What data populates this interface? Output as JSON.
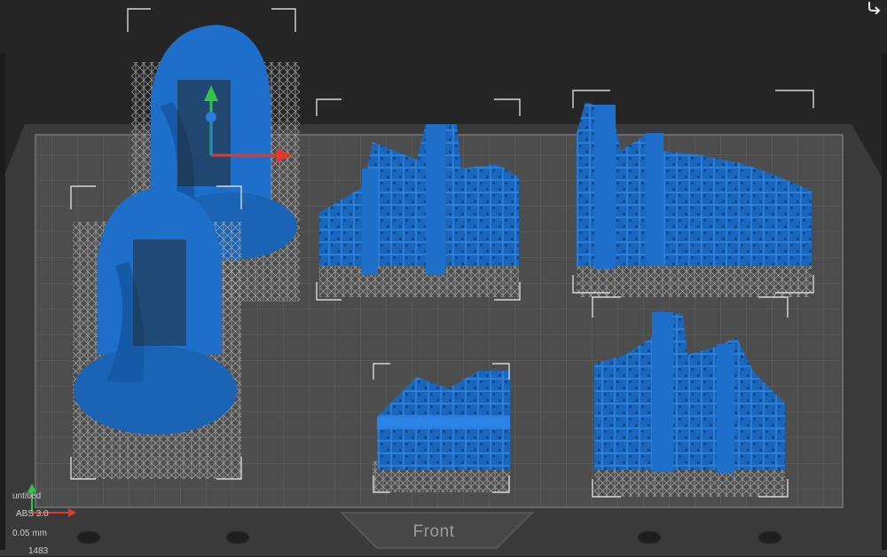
{
  "viewport": {
    "plate_label": "Front",
    "plate_color": "#4d4d4d",
    "grid_color": "#5c5c5c",
    "model_color": "#1e6fc9",
    "support_color": "#a7a7a7",
    "model_count": 6
  },
  "gizmo": {
    "x_axis_color": "#e03a2a",
    "y_axis_color": "#2fc44a",
    "z_axis_color": "#2a7ae0"
  },
  "info": {
    "project_name": "untitled",
    "resin": "ABS 3.0",
    "layer_height": "0.05 mm",
    "layer_count": "1483"
  },
  "icons": {
    "corner_action": "redo-arrow-icon"
  }
}
